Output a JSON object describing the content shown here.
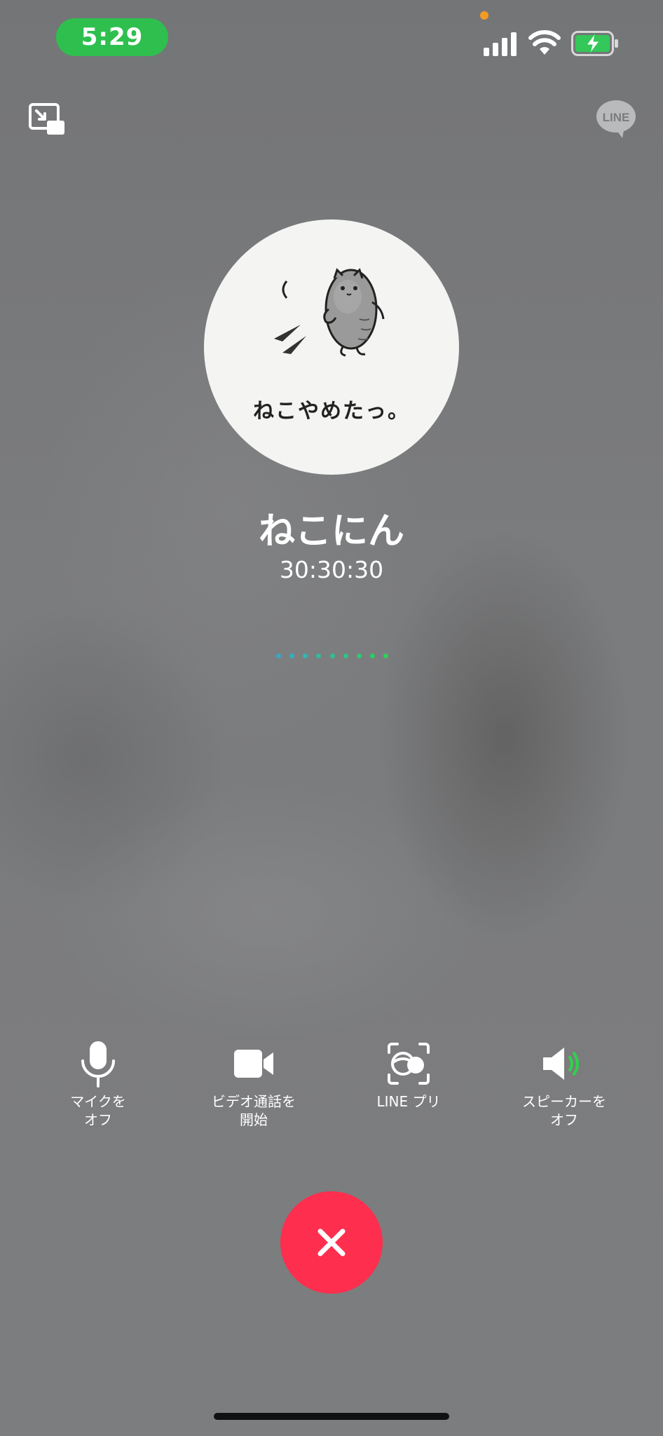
{
  "status_bar": {
    "time": "5:29"
  },
  "caller": {
    "name": "ねこにん",
    "duration": "30:30:30",
    "avatar_caption": "ねこやめたっ。"
  },
  "top_bar": {
    "pip_icon": "picture-in-picture-icon",
    "logo_text": "LINE"
  },
  "controls": [
    {
      "icon": "microphone-icon",
      "label": "マイクを\nオフ"
    },
    {
      "icon": "video-camera-icon",
      "label": "ビデオ通話を\n開始"
    },
    {
      "icon": "face-filter-icon",
      "label": "LINE プリ"
    },
    {
      "icon": "speaker-icon",
      "label": "スピーカーを\nオフ"
    }
  ],
  "end_call": {
    "icon": "close-icon"
  },
  "colors": {
    "time_pill": "#2fbf4e",
    "end_call": "#fe2e4e",
    "speaker_wave": "#2fd24a",
    "battery_fill": "#34c759",
    "recording_dot": "#f29a24"
  }
}
